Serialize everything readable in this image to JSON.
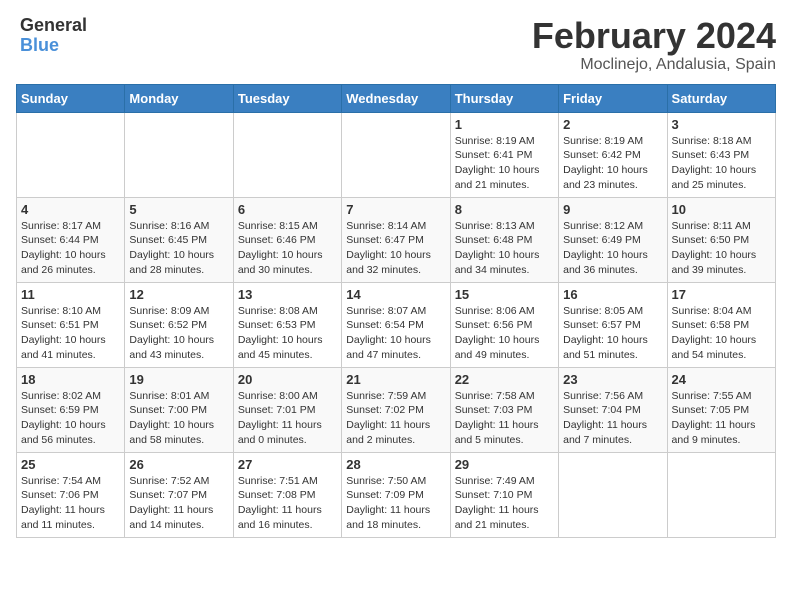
{
  "header": {
    "logo_general": "General",
    "logo_blue": "Blue",
    "month": "February 2024",
    "location": "Moclinejo, Andalusia, Spain"
  },
  "weekdays": [
    "Sunday",
    "Monday",
    "Tuesday",
    "Wednesday",
    "Thursday",
    "Friday",
    "Saturday"
  ],
  "weeks": [
    [
      {
        "day": "",
        "info": ""
      },
      {
        "day": "",
        "info": ""
      },
      {
        "day": "",
        "info": ""
      },
      {
        "day": "",
        "info": ""
      },
      {
        "day": "1",
        "info": "Sunrise: 8:19 AM\nSunset: 6:41 PM\nDaylight: 10 hours and 21 minutes."
      },
      {
        "day": "2",
        "info": "Sunrise: 8:19 AM\nSunset: 6:42 PM\nDaylight: 10 hours and 23 minutes."
      },
      {
        "day": "3",
        "info": "Sunrise: 8:18 AM\nSunset: 6:43 PM\nDaylight: 10 hours and 25 minutes."
      }
    ],
    [
      {
        "day": "4",
        "info": "Sunrise: 8:17 AM\nSunset: 6:44 PM\nDaylight: 10 hours and 26 minutes."
      },
      {
        "day": "5",
        "info": "Sunrise: 8:16 AM\nSunset: 6:45 PM\nDaylight: 10 hours and 28 minutes."
      },
      {
        "day": "6",
        "info": "Sunrise: 8:15 AM\nSunset: 6:46 PM\nDaylight: 10 hours and 30 minutes."
      },
      {
        "day": "7",
        "info": "Sunrise: 8:14 AM\nSunset: 6:47 PM\nDaylight: 10 hours and 32 minutes."
      },
      {
        "day": "8",
        "info": "Sunrise: 8:13 AM\nSunset: 6:48 PM\nDaylight: 10 hours and 34 minutes."
      },
      {
        "day": "9",
        "info": "Sunrise: 8:12 AM\nSunset: 6:49 PM\nDaylight: 10 hours and 36 minutes."
      },
      {
        "day": "10",
        "info": "Sunrise: 8:11 AM\nSunset: 6:50 PM\nDaylight: 10 hours and 39 minutes."
      }
    ],
    [
      {
        "day": "11",
        "info": "Sunrise: 8:10 AM\nSunset: 6:51 PM\nDaylight: 10 hours and 41 minutes."
      },
      {
        "day": "12",
        "info": "Sunrise: 8:09 AM\nSunset: 6:52 PM\nDaylight: 10 hours and 43 minutes."
      },
      {
        "day": "13",
        "info": "Sunrise: 8:08 AM\nSunset: 6:53 PM\nDaylight: 10 hours and 45 minutes."
      },
      {
        "day": "14",
        "info": "Sunrise: 8:07 AM\nSunset: 6:54 PM\nDaylight: 10 hours and 47 minutes."
      },
      {
        "day": "15",
        "info": "Sunrise: 8:06 AM\nSunset: 6:56 PM\nDaylight: 10 hours and 49 minutes."
      },
      {
        "day": "16",
        "info": "Sunrise: 8:05 AM\nSunset: 6:57 PM\nDaylight: 10 hours and 51 minutes."
      },
      {
        "day": "17",
        "info": "Sunrise: 8:04 AM\nSunset: 6:58 PM\nDaylight: 10 hours and 54 minutes."
      }
    ],
    [
      {
        "day": "18",
        "info": "Sunrise: 8:02 AM\nSunset: 6:59 PM\nDaylight: 10 hours and 56 minutes."
      },
      {
        "day": "19",
        "info": "Sunrise: 8:01 AM\nSunset: 7:00 PM\nDaylight: 10 hours and 58 minutes."
      },
      {
        "day": "20",
        "info": "Sunrise: 8:00 AM\nSunset: 7:01 PM\nDaylight: 11 hours and 0 minutes."
      },
      {
        "day": "21",
        "info": "Sunrise: 7:59 AM\nSunset: 7:02 PM\nDaylight: 11 hours and 2 minutes."
      },
      {
        "day": "22",
        "info": "Sunrise: 7:58 AM\nSunset: 7:03 PM\nDaylight: 11 hours and 5 minutes."
      },
      {
        "day": "23",
        "info": "Sunrise: 7:56 AM\nSunset: 7:04 PM\nDaylight: 11 hours and 7 minutes."
      },
      {
        "day": "24",
        "info": "Sunrise: 7:55 AM\nSunset: 7:05 PM\nDaylight: 11 hours and 9 minutes."
      }
    ],
    [
      {
        "day": "25",
        "info": "Sunrise: 7:54 AM\nSunset: 7:06 PM\nDaylight: 11 hours and 11 minutes."
      },
      {
        "day": "26",
        "info": "Sunrise: 7:52 AM\nSunset: 7:07 PM\nDaylight: 11 hours and 14 minutes."
      },
      {
        "day": "27",
        "info": "Sunrise: 7:51 AM\nSunset: 7:08 PM\nDaylight: 11 hours and 16 minutes."
      },
      {
        "day": "28",
        "info": "Sunrise: 7:50 AM\nSunset: 7:09 PM\nDaylight: 11 hours and 18 minutes."
      },
      {
        "day": "29",
        "info": "Sunrise: 7:49 AM\nSunset: 7:10 PM\nDaylight: 11 hours and 21 minutes."
      },
      {
        "day": "",
        "info": ""
      },
      {
        "day": "",
        "info": ""
      }
    ]
  ]
}
